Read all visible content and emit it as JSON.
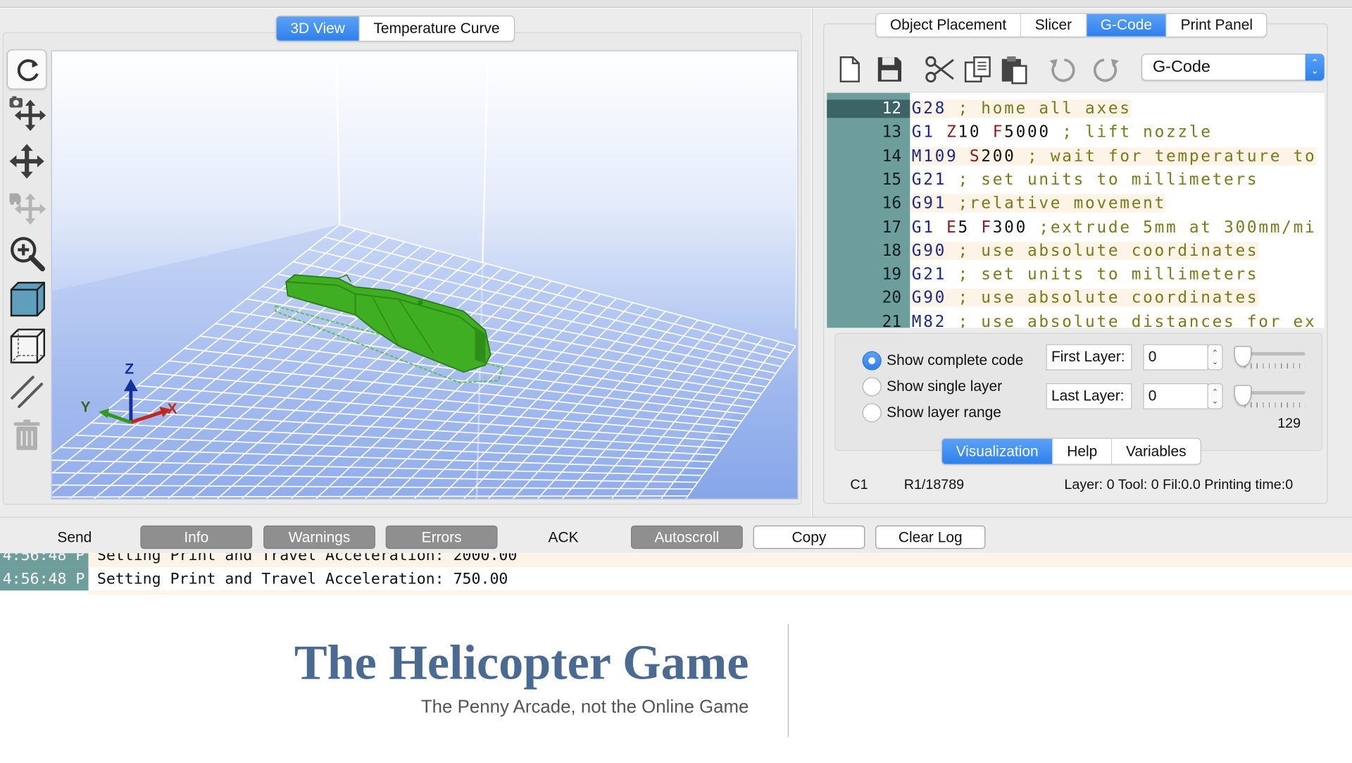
{
  "left_tabs": [
    {
      "label": "3D View",
      "active": true
    },
    {
      "label": "Temperature Curve",
      "active": false
    }
  ],
  "view_tools": [
    {
      "icon": "refresh-icon"
    },
    {
      "icon": "camera-move-icon"
    },
    {
      "icon": "move-icon"
    },
    {
      "icon": "move-object-icon"
    },
    {
      "icon": "zoom-in-icon"
    },
    {
      "icon": "cube-solid-icon"
    },
    {
      "icon": "cube-wireframe-icon"
    },
    {
      "icon": "slash-icon"
    },
    {
      "icon": "trash-icon"
    }
  ],
  "axes": {
    "x": "X",
    "y": "Y",
    "z": "Z"
  },
  "right_tabs": [
    {
      "label": "Object Placement",
      "active": false
    },
    {
      "label": "Slicer",
      "active": false
    },
    {
      "label": "G-Code",
      "active": true
    },
    {
      "label": "Print Panel",
      "active": false
    }
  ],
  "editor_tools": [
    "new-file-icon",
    "save-icon",
    "cut-icon",
    "copy-icon",
    "paste-icon",
    "undo-icon",
    "redo-icon"
  ],
  "code_select": {
    "value": "G-Code"
  },
  "code_lines": [
    {
      "n": "12",
      "parts": [
        [
          "cmd",
          "G28"
        ],
        [
          "cmt",
          " ; home all axes"
        ]
      ]
    },
    {
      "n": "13",
      "parts": [
        [
          "cmd",
          "G1"
        ],
        [
          "val",
          " "
        ],
        [
          "par",
          "Z"
        ],
        [
          "val",
          "10 "
        ],
        [
          "par",
          "F"
        ],
        [
          "val",
          "5000"
        ],
        [
          "cmt",
          " ; lift nozzle"
        ]
      ]
    },
    {
      "n": "14",
      "parts": [
        [
          "cmd",
          "M109"
        ],
        [
          "val",
          " "
        ],
        [
          "par",
          "S"
        ],
        [
          "val",
          "200"
        ],
        [
          "cmt",
          " ; wait for temperature to"
        ]
      ]
    },
    {
      "n": "15",
      "parts": [
        [
          "cmd",
          "G21"
        ],
        [
          "cmt",
          " ; set units to millimeters"
        ]
      ]
    },
    {
      "n": "16",
      "parts": [
        [
          "cmd",
          "G91"
        ],
        [
          "cmt",
          " ;relative movement"
        ]
      ]
    },
    {
      "n": "17",
      "parts": [
        [
          "cmd",
          "G1"
        ],
        [
          "val",
          " "
        ],
        [
          "par",
          "E"
        ],
        [
          "val",
          "5 "
        ],
        [
          "par",
          "F"
        ],
        [
          "val",
          "300"
        ],
        [
          "cmt",
          " ;extrude 5mm at 300mm/mi"
        ]
      ]
    },
    {
      "n": "18",
      "parts": [
        [
          "cmd",
          "G90"
        ],
        [
          "cmt",
          " ; use absolute coordinates"
        ]
      ]
    },
    {
      "n": "19",
      "parts": [
        [
          "cmd",
          "G21"
        ],
        [
          "cmt",
          " ; set units to millimeters"
        ]
      ]
    },
    {
      "n": "20",
      "parts": [
        [
          "cmd",
          "G90"
        ],
        [
          "cmt",
          " ; use absolute coordinates"
        ]
      ]
    },
    {
      "n": "21",
      "parts": [
        [
          "cmd",
          "M82"
        ],
        [
          "cmt",
          " ; use absolute distances for ex"
        ]
      ]
    }
  ],
  "radios": [
    {
      "label": "Show complete code",
      "checked": true
    },
    {
      "label": "Show single layer",
      "checked": false
    },
    {
      "label": "Show layer range",
      "checked": false
    }
  ],
  "first_layer": {
    "label": "First Layer:",
    "value": "0"
  },
  "last_layer": {
    "label": "Last Layer:",
    "value": "0"
  },
  "layer_max": "129",
  "bottom_tabs": [
    {
      "label": "Visualization",
      "active": true
    },
    {
      "label": "Help",
      "active": false
    },
    {
      "label": "Variables",
      "active": false
    }
  ],
  "status": {
    "col": "C1",
    "row": "R1/18789",
    "info": "Layer: 0 Tool: 0 Fil:0.0 Printing time:0"
  },
  "log_toolbar": {
    "send": "Send",
    "info": "Info",
    "warnings": "Warnings",
    "errors": "Errors",
    "ack": "ACK",
    "autoscroll": "Autoscroll",
    "copy": "Copy",
    "clear_log": "Clear Log"
  },
  "log_lines": [
    {
      "time": "4:56:48 P",
      "msg": "Setting Print and Travel Acceleration: 2000.00"
    },
    {
      "time": "4:56:48 P",
      "msg": "Setting Print and Travel Acceleration: 750.00"
    }
  ],
  "slide": {
    "title": "The Helicopter Game",
    "subtitle": "The Penny Arcade, not the Online Game"
  },
  "colors": {
    "accent": "#2f80ee",
    "gutter": "#6e9e9b",
    "model": "#3cae22",
    "title": "#4a6a92"
  }
}
